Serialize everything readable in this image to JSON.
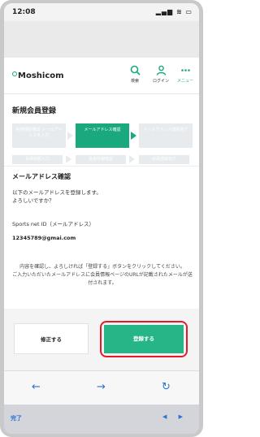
{
  "status_bar": {
    "time": "12:08",
    "icons": "▂▄▆ ≋ ▭"
  },
  "header": {
    "logo": "Moshicom",
    "search_label": "検索",
    "login_label": "ログイン",
    "menu_label": "メニュー"
  },
  "page_title": "新規会員登録",
  "steps": {
    "step1": "利用規約確認\nメールアドレスを入力",
    "step2": "メールアドレス確認",
    "step3": "メールアドレス登録完了",
    "sub1": "会員情報入力",
    "sub2": "会員情報確認",
    "sub3": "会員登録完了"
  },
  "section_title": "メールアドレス確認",
  "description_line1": "以下のメールアドレスを登録します。",
  "description_line2": "よろしいですか？",
  "field_label": "Sports net ID（メールアドレス）",
  "field_value": "12345789@gmai.com",
  "notice_line1": "内容を確認し、よろしければ「登録する」ボタンをクリックしてください。",
  "notice_line2": "ご入力いただいたメールアドレスに会員情報ページのURLが記載されたメールが送付されます。",
  "buttons": {
    "fix": "修正する",
    "register": "登録する"
  },
  "toolbar": {
    "back": "←",
    "forward": "→",
    "reload": "↻"
  },
  "keyboard_bar": {
    "done": "完了",
    "arrows": "◀ ▶"
  },
  "colors": {
    "accent": "#1aa97f",
    "highlight": "#e8182c",
    "link": "#2b73d4"
  }
}
